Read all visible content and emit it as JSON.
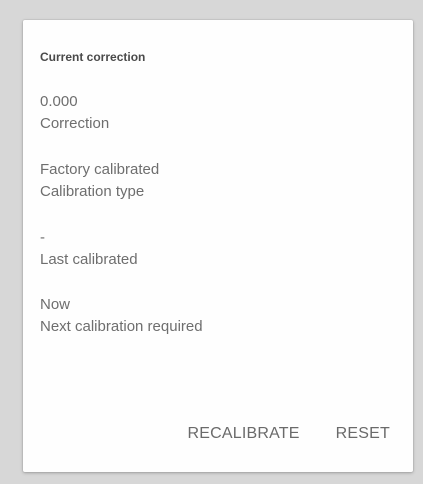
{
  "card": {
    "title": "Current correction",
    "items": [
      {
        "value": "0.000",
        "label": "Correction"
      },
      {
        "value": "Factory calibrated",
        "label": "Calibration type"
      },
      {
        "value": "-",
        "label": "Last calibrated"
      },
      {
        "value": "Now",
        "label": "Next calibration required"
      }
    ],
    "actions": {
      "recalibrate": "RECALIBRATE",
      "reset": "RESET"
    }
  }
}
